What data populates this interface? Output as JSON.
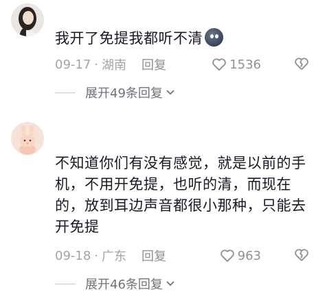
{
  "comments": [
    {
      "text": "我开了免提我都听不清",
      "date": "09-17",
      "separator": "·",
      "location": "湖南",
      "reply_label": "回复",
      "likes": "1536",
      "expand_label": "展开49条回复"
    },
    {
      "text": "不知道你们有没有感觉，就是以前的手机，不用开免提，也听的清，而现在的，放到耳边声音都很小那种，只能去开免提",
      "date": "09-18",
      "separator": "·",
      "location": "广东",
      "reply_label": "回复",
      "likes": "963",
      "expand_label": "展开46条回复"
    }
  ],
  "colors": {
    "meta": "#a1a3a9",
    "text": "#161823",
    "expand": "#6f7178"
  }
}
